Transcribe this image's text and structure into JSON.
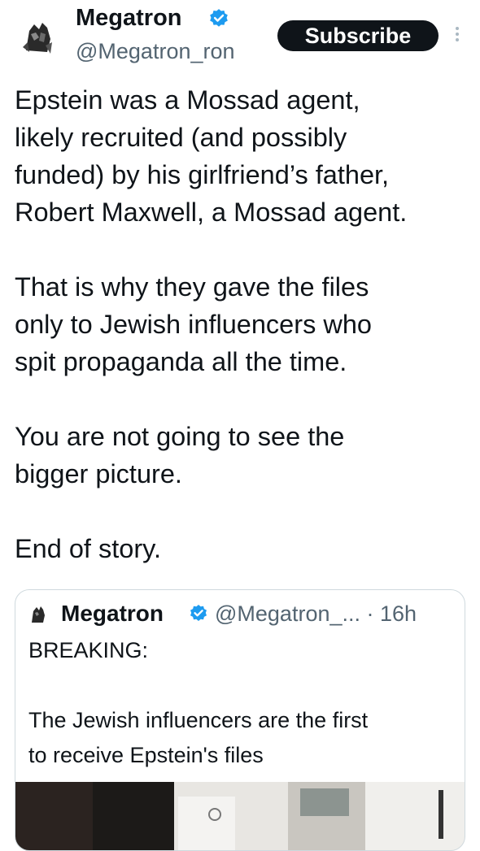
{
  "post": {
    "author_name": "Megatron",
    "author_handle": "@Megatron_ron",
    "subscribe_label": "Subscribe",
    "paragraphs": [
      [
        "Epstein was a Mossad agent,",
        "likely recruited (and possibly",
        "funded) by his girlfriend’s father,",
        "Robert Maxwell, a Mossad agent."
      ],
      [
        "That is why they gave the files",
        "only to Jewish influencers who",
        "spit propaganda all the time."
      ],
      [
        "You are not going to see the",
        "bigger picture."
      ],
      [
        "End of story."
      ]
    ]
  },
  "quote": {
    "author_name": "Megatron",
    "handle_time": "@Megatron_... · 16h",
    "line1": "BREAKING:",
    "line2": "The Jewish influencers are the first",
    "line3": "to receive Epstein's files"
  },
  "icons": {
    "avatar": "avatar-icon",
    "verified": "verified-badge-icon",
    "more": "more-options-icon"
  },
  "colors": {
    "verified": "#1d9bf0",
    "subscribe_bg": "#0f1419",
    "secondary_text": "#536471"
  }
}
